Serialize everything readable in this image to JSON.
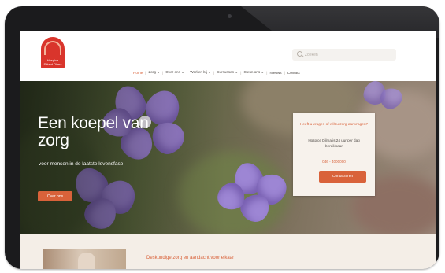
{
  "header": {
    "logo_text": "Hospice Sittard Dilma",
    "search": {
      "placeholder": "Zoeken"
    },
    "nav": [
      {
        "label": "Home",
        "active": true
      },
      {
        "label": "Zorg ⌄"
      },
      {
        "label": "Over ons ⌄"
      },
      {
        "label": "Werken bij ⌄"
      },
      {
        "label": "Cursussen ⌄"
      },
      {
        "label": "Steun ons ⌄"
      },
      {
        "label": "Nieuws"
      },
      {
        "label": "Contact"
      }
    ]
  },
  "hero": {
    "title": "Een koepel van zorg",
    "subtitle": "voor mensen in de laatste levensfase",
    "button_label": "Over ons"
  },
  "info_card": {
    "heading": "Heeft u vragen of wilt u zorg aanvragen?",
    "text": "Hospice Dilma is 24 uur per dag bereikbaar",
    "phone": "046 - 4000000",
    "button_label": "Contacteren"
  },
  "section": {
    "heading": "Deskundige zorg en aandacht voor elkaar"
  },
  "colors": {
    "accent": "#d9623a",
    "brand_red": "#d9352c",
    "card_bg": "#f7f2ec",
    "section_bg": "#f4eee7",
    "device_frame": "#1b1b1d"
  }
}
